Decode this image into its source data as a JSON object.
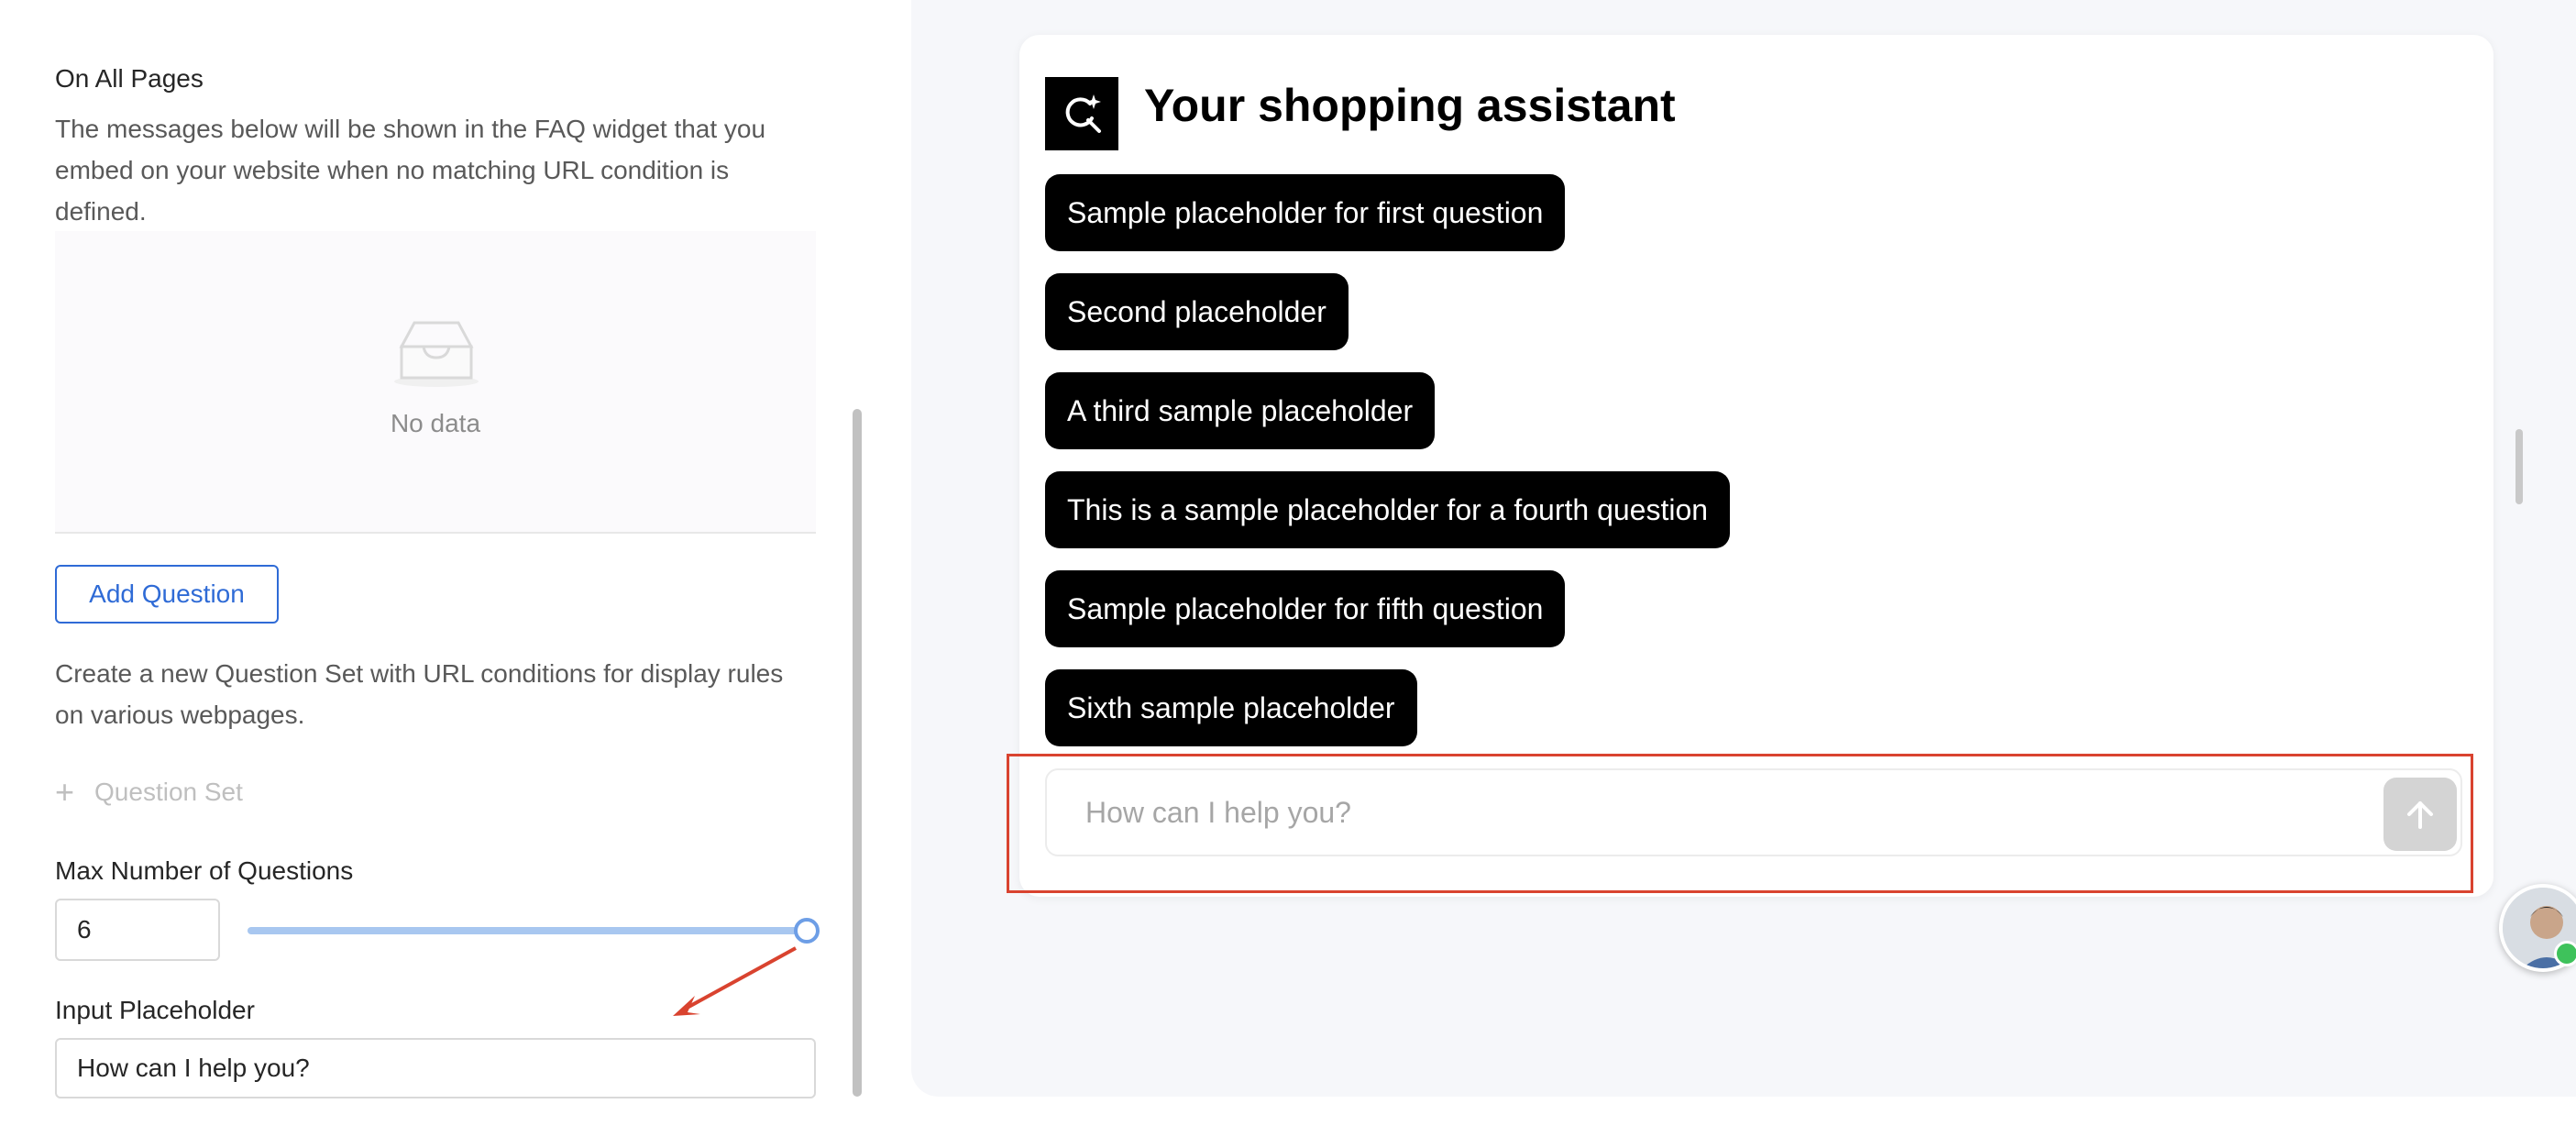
{
  "left_panel": {
    "section_title": "On All Pages",
    "description": "The messages below will be shown in the FAQ widget that you embed on your website when no matching URL condition is defined.",
    "empty_state": {
      "icon": "inbox-icon",
      "text": "No data"
    },
    "add_question_label": "Add Question",
    "create_description": "Create a new Question Set with URL conditions for display rules on various webpages.",
    "question_set_label": "Question Set",
    "max_questions": {
      "label": "Max Number of Questions",
      "value": "6",
      "slider_fraction": 1.0
    },
    "input_placeholder": {
      "label": "Input Placeholder",
      "value": "How can I help you?"
    }
  },
  "preview": {
    "title": "Your shopping assistant",
    "logo_icon": "search-sparkle-icon",
    "questions": [
      "Sample placeholder for first question",
      "Second placeholder",
      "A third sample placeholder",
      "This is a sample placeholder for a fourth question",
      "Sample placeholder for fifth question",
      "Sixth sample placeholder"
    ],
    "chat_placeholder": "How can I help you?",
    "send_icon": "arrow-up-icon"
  },
  "colors": {
    "accent_blue": "#2f6bd6",
    "chip_bg": "#000000",
    "annotation_red": "#d9432f",
    "online_green": "#3ec25b"
  }
}
